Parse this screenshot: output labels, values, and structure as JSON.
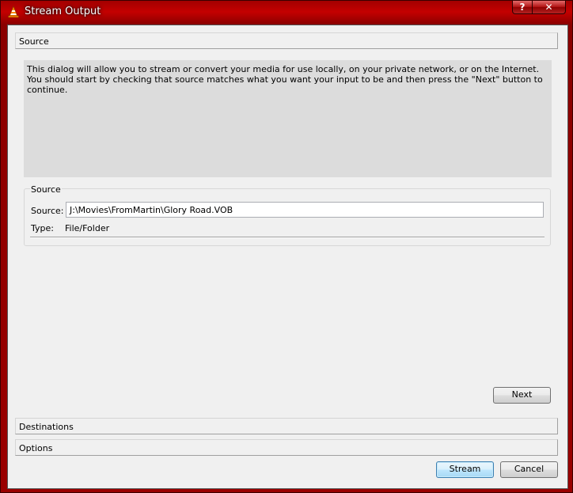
{
  "window": {
    "title": "Stream Output",
    "help_glyph": "?",
    "close_glyph": "✕"
  },
  "sections": {
    "source": "Source",
    "destinations": "Destinations",
    "options": "Options"
  },
  "description": {
    "line1": "This dialog will allow you to stream or convert your media for use locally, on your private network, or on the Internet.",
    "line2": "You should start by checking that source matches what you want your input to be and then press the \"Next\" button to continue."
  },
  "source_group": {
    "title": "Source",
    "source_label": "Source:",
    "source_value": "J:\\Movies\\FromMartin\\Glory Road.VOB",
    "type_label": "Type:",
    "type_value": "File/Folder"
  },
  "buttons": {
    "next": "Next",
    "stream": "Stream",
    "cancel": "Cancel"
  },
  "colors": {
    "title_bar": "#b40000",
    "dialog_bg": "#f0f0f0",
    "description_bg": "#dcdcdc",
    "default_button_border": "#3c7fb1"
  },
  "icons": {
    "app": "vlc-cone-icon",
    "help": "help-icon",
    "close": "close-icon"
  }
}
